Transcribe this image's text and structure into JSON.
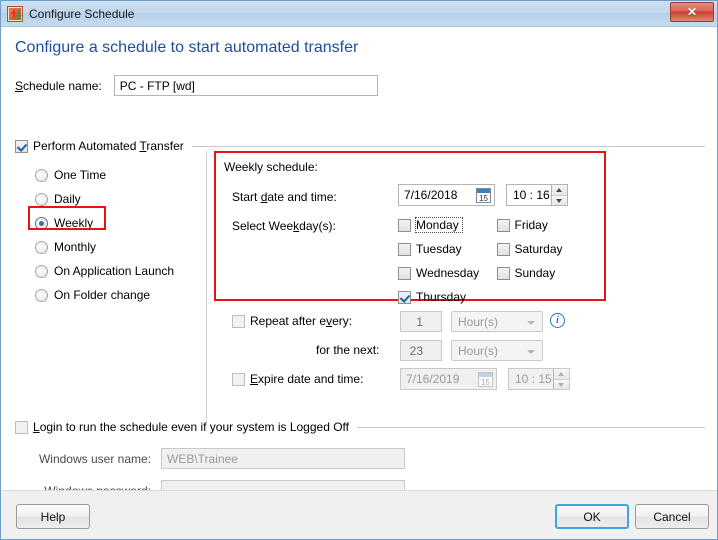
{
  "window": {
    "title": "Configure Schedule",
    "icon": "transfer-arrows-icon",
    "close_label": "✕",
    "accent_blue": "#1f4e9c",
    "highlight_red": "#ee1111"
  },
  "heading": "Configure a schedule to start automated transfer",
  "schedule_name": {
    "label": "Schedule name:",
    "value": "PC - FTP [wd]"
  },
  "perform_transfer": {
    "label": "Perform Automated Transfer",
    "checked": true
  },
  "frequency_options": [
    {
      "label": "One Time",
      "selected": false
    },
    {
      "label": "Daily",
      "selected": false
    },
    {
      "label": "Weekly",
      "selected": true
    },
    {
      "label": "Monthly",
      "selected": false
    },
    {
      "label": "On Application Launch",
      "selected": false
    },
    {
      "label": "On Folder change",
      "selected": false
    }
  ],
  "weekly_panel": {
    "title": "Weekly schedule:",
    "start_label": "Start date and time:",
    "start_date": "7/16/2018",
    "start_time": "10 : 16",
    "calendar_icon_day": "15",
    "weekday_label": "Select Weekday(s):",
    "weekdays_col1": [
      {
        "label": "Monday",
        "checked": false,
        "focused": true
      },
      {
        "label": "Tuesday",
        "checked": false,
        "focused": false
      },
      {
        "label": "Wednesday",
        "checked": false,
        "focused": false
      },
      {
        "label": "Thursday",
        "checked": true,
        "focused": false
      }
    ],
    "weekdays_col2": [
      {
        "label": "Friday",
        "checked": false
      },
      {
        "label": "Saturday",
        "checked": false
      },
      {
        "label": "Sunday",
        "checked": false
      }
    ]
  },
  "repeat": {
    "repeat_label": "Repeat after every:",
    "repeat_checked": false,
    "repeat_value": "1",
    "repeat_unit": "Hour(s)",
    "info_icon_glyph": "i",
    "next_label": "for the next:",
    "next_value": "23",
    "next_unit": "Hour(s)",
    "expire_label": "Expire date and time:",
    "expire_checked": false,
    "expire_date": "7/16/2019",
    "expire_time": "10 : 15",
    "calendar_icon_day": "15"
  },
  "login": {
    "label": "Login to run the schedule even if your system is Logged Off",
    "checked": false,
    "user_label": "Windows user name:",
    "user_value": "WEB\\Trainee",
    "password_label": "Windows password:",
    "password_value": ""
  },
  "footer": {
    "help": "Help",
    "ok": "OK",
    "cancel": "Cancel"
  }
}
